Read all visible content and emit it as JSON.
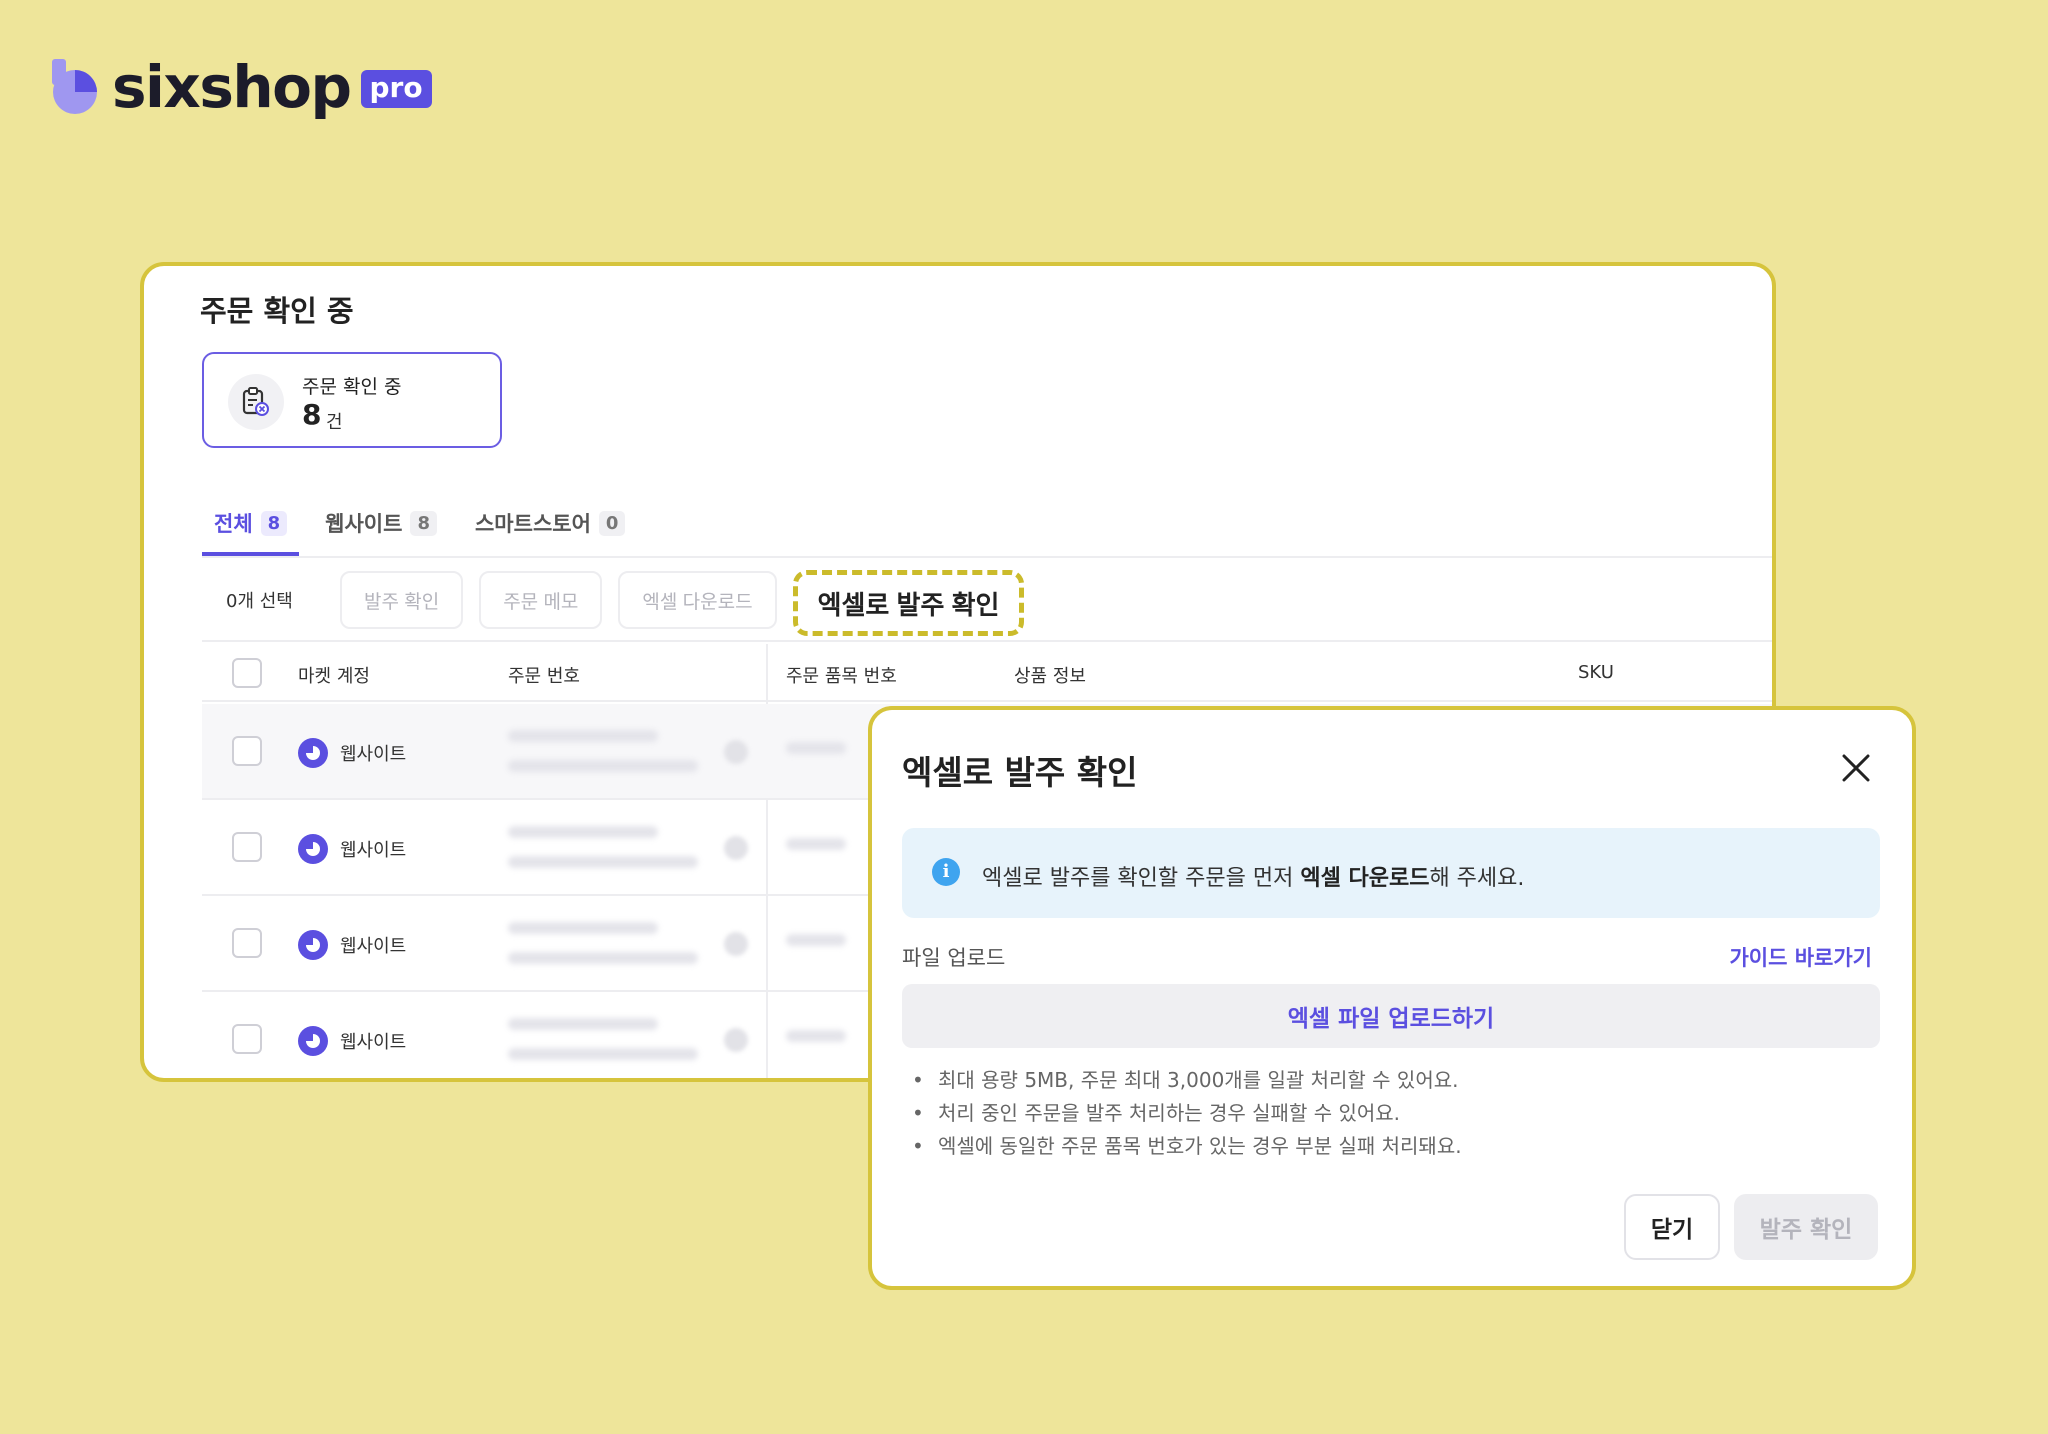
{
  "logo": {
    "name": "sixshop",
    "badge": "pro"
  },
  "page": {
    "title": "주문 확인 중",
    "summary": {
      "label": "주문 확인 중",
      "count": "8",
      "unit": "건"
    }
  },
  "tabs": [
    {
      "label": "전체",
      "count": "8",
      "active": true
    },
    {
      "label": "웹사이트",
      "count": "8",
      "active": false
    },
    {
      "label": "스마트스토어",
      "count": "0",
      "active": false
    }
  ],
  "toolbar": {
    "selected": "0개 선택",
    "confirm_order": "발주 확인",
    "order_memo": "주문 메모",
    "excel_download": "엑셀 다운로드",
    "excel_confirm": "엑셀로 발주 확인"
  },
  "table": {
    "headers": {
      "market": "마켓 계정",
      "order_no": "주문 번호",
      "item_no": "주문 품목 번호",
      "product": "상품 정보",
      "sku": "SKU"
    },
    "rows": [
      {
        "market": "웹사이트"
      },
      {
        "market": "웹사이트"
      },
      {
        "market": "웹사이트"
      },
      {
        "market": "웹사이트"
      }
    ]
  },
  "dialog": {
    "title": "엑셀로 발주 확인",
    "info_prefix": "엑셀로 발주를 확인할 주문을 먼저 ",
    "info_bold": "엑셀 다운로드",
    "info_suffix": "해 주세요.",
    "upload_label": "파일 업로드",
    "guide_link": "가이드 바로가기",
    "upload_button": "엑셀 파일 업로드하기",
    "notes": [
      "최대 용량 5MB, 주문 최대 3,000개를 일괄 처리할 수 있어요.",
      "처리 중인 주문을 발주 처리하는 경우 실패할 수 있어요.",
      "엑셀에 동일한 주문 품목 번호가 있는 경우 부분 실패 처리돼요."
    ],
    "close_button": "닫기",
    "confirm_button": "발주 확인"
  },
  "colors": {
    "background": "#EEE59A",
    "accent": "#5B4FE0",
    "highlight_border": "#D6C43C",
    "info_bg": "#E7F3FB",
    "info_icon": "#3FA4EF"
  }
}
